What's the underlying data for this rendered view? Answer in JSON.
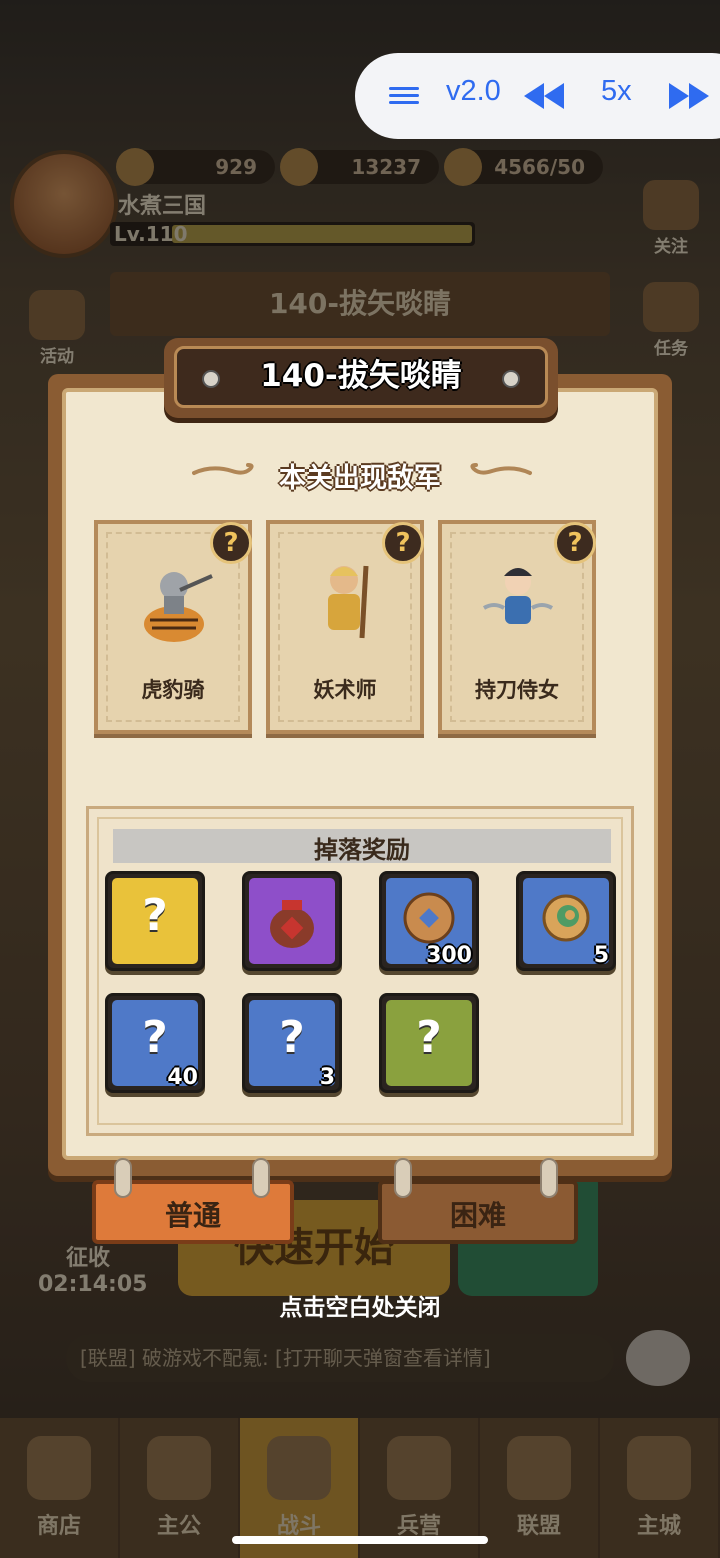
{
  "overlay": {
    "version": "v2.0",
    "speed": "5x",
    "icons": [
      "menu-icon",
      "rewind-icon",
      "fast-forward-icon"
    ],
    "accent": "#2f6bf0"
  },
  "background": {
    "resources": [
      "929",
      "13237",
      "4566/50"
    ],
    "player_name": "水煮三国",
    "player_level": "Lv.110",
    "stage_banner": "140-拔矢啖睛",
    "side_left": [
      "活动"
    ],
    "side_right": [
      "关注",
      "任务"
    ],
    "chat_text": "[联盟] 破游戏不配氪: [打开聊天弹窗查看详情]",
    "timer_label": "征收",
    "timer_value": "02:14:05",
    "quick_start": "快速开始",
    "bottom_tabs": [
      "商店",
      "主公",
      "战斗",
      "兵营",
      "联盟",
      "主城"
    ]
  },
  "modal": {
    "title": "140-拔矢啖睛",
    "enemy_section": "本关出现敌军",
    "enemies": [
      {
        "name": "虎豹骑",
        "icon": "tiger-rider-icon"
      },
      {
        "name": "妖术师",
        "icon": "sorcerer-icon"
      },
      {
        "name": "持刀侍女",
        "icon": "blade-maiden-icon"
      }
    ],
    "reward_section": "掉落奖励",
    "rewards": [
      {
        "icon": "mystery-chest-icon",
        "count": "",
        "bg": "#e9c23a"
      },
      {
        "icon": "wine-jar-icon",
        "count": "",
        "bg": "#8e4fc9"
      },
      {
        "icon": "copper-coin-icon",
        "count": "300",
        "bg": "#4f79c8"
      },
      {
        "icon": "jade-swirl-icon",
        "count": "5",
        "bg": "#4f79c8"
      },
      {
        "icon": "mystery-scroll-icon",
        "count": "40",
        "bg": "#4f79c8"
      },
      {
        "icon": "mystery-map-icon",
        "count": "3",
        "bg": "#4f79c8"
      },
      {
        "icon": "mystery-armor-icon",
        "count": "",
        "bg": "#8aa13e"
      }
    ],
    "difficulty": {
      "normal": "普通",
      "hard": "困难"
    },
    "close_hint": "点击空白处关闭"
  }
}
